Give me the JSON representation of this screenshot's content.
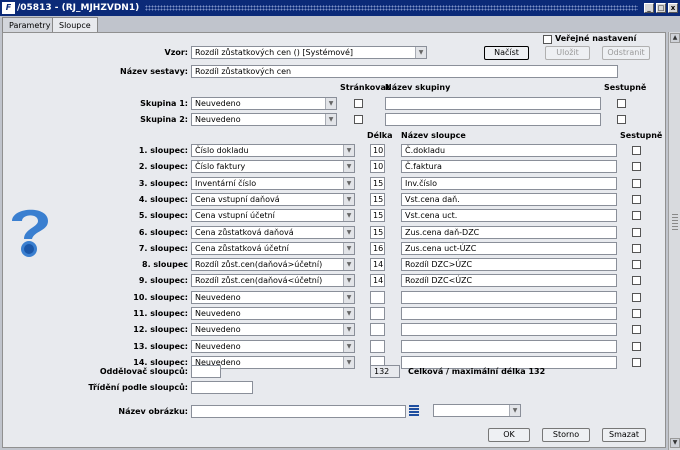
{
  "window": {
    "title": "/05813 - (RJ_MJHZVDN1)",
    "min": "_",
    "max": "□",
    "close": "x"
  },
  "tabs": [
    "Parametry",
    "Sloupce"
  ],
  "top": {
    "vzor_label": "Vzor:",
    "vzor_value": "Rozdíl zůstatkových cen   ()   [Systémové]",
    "nacist": "Načíst",
    "ulozit": "Uložit",
    "odstranit": "Odstranit",
    "verejne": "Veřejné nastavení",
    "nazev_sestavy_label": "Název sestavy:",
    "nazev_sestavy_value": "Rozdíl zůstatkových cen"
  },
  "groups": {
    "hdr_strankovat": "Stránkovat",
    "hdr_nazev": "Název skupiny",
    "hdr_sestupne": "Sestupně",
    "rows": [
      {
        "label": "Skupina 1:",
        "value": "Neuvedeno"
      },
      {
        "label": "Skupina 2:",
        "value": "Neuvedeno"
      }
    ]
  },
  "columns": {
    "hdr_delka": "Délka",
    "hdr_nazev": "Název sloupce",
    "hdr_sestupne": "Sestupně",
    "rows": [
      {
        "label": "1. sloupec:",
        "value": "Číslo dokladu",
        "len": "10",
        "name": "Č.dokladu"
      },
      {
        "label": "2. sloupec:",
        "value": "Číslo faktury",
        "len": "10",
        "name": "Č.faktura"
      },
      {
        "label": "3. sloupec:",
        "value": "Inventární číslo",
        "len": "15",
        "name": "Inv.číslo"
      },
      {
        "label": "4. sloupec:",
        "value": "Cena vstupní daňová",
        "len": "15",
        "name": "Vst.cena daň."
      },
      {
        "label": "5. sloupec:",
        "value": "Cena vstupní účetní",
        "len": "15",
        "name": "Vst.cena uct."
      },
      {
        "label": "6. sloupec:",
        "value": "Cena zůstatková daňová",
        "len": "15",
        "name": "Zus.cena daň-DZC"
      },
      {
        "label": "7. sloupec:",
        "value": "Cena zůstatková účetní",
        "len": "16",
        "name": "Zus.cena uct-ÚZC"
      },
      {
        "label": "8. sloupec",
        "value": "Rozdíl zůst.cen(daňová>účetní)",
        "len": "14",
        "name": "Rozdíl DZC>ÚZC"
      },
      {
        "label": "9. sloupec:",
        "value": "Rozdíl zůst.cen(daňová<účetní)",
        "len": "14",
        "name": "Rozdíl DZC<ÚZC"
      },
      {
        "label": "10. sloupec:",
        "value": "Neuvedeno",
        "len": "",
        "name": ""
      },
      {
        "label": "11. sloupec:",
        "value": "Neuvedeno",
        "len": "",
        "name": ""
      },
      {
        "label": "12. sloupec:",
        "value": "Neuvedeno",
        "len": "",
        "name": ""
      },
      {
        "label": "13. sloupec:",
        "value": "Neuvedeno",
        "len": "",
        "name": ""
      },
      {
        "label": "14. sloupec:",
        "value": "Neuvedeno",
        "len": "",
        "name": ""
      }
    ]
  },
  "bottom": {
    "oddelovac_label": "Oddělovač sloupců:",
    "total": "132",
    "total_text": "Celková / maximální délka 132",
    "trideni_label": "Třídění podle sloupců:",
    "obrazek_label": "Název obrázku:",
    "ok": "OK",
    "storno": "Storno",
    "smazat": "Smazat"
  }
}
